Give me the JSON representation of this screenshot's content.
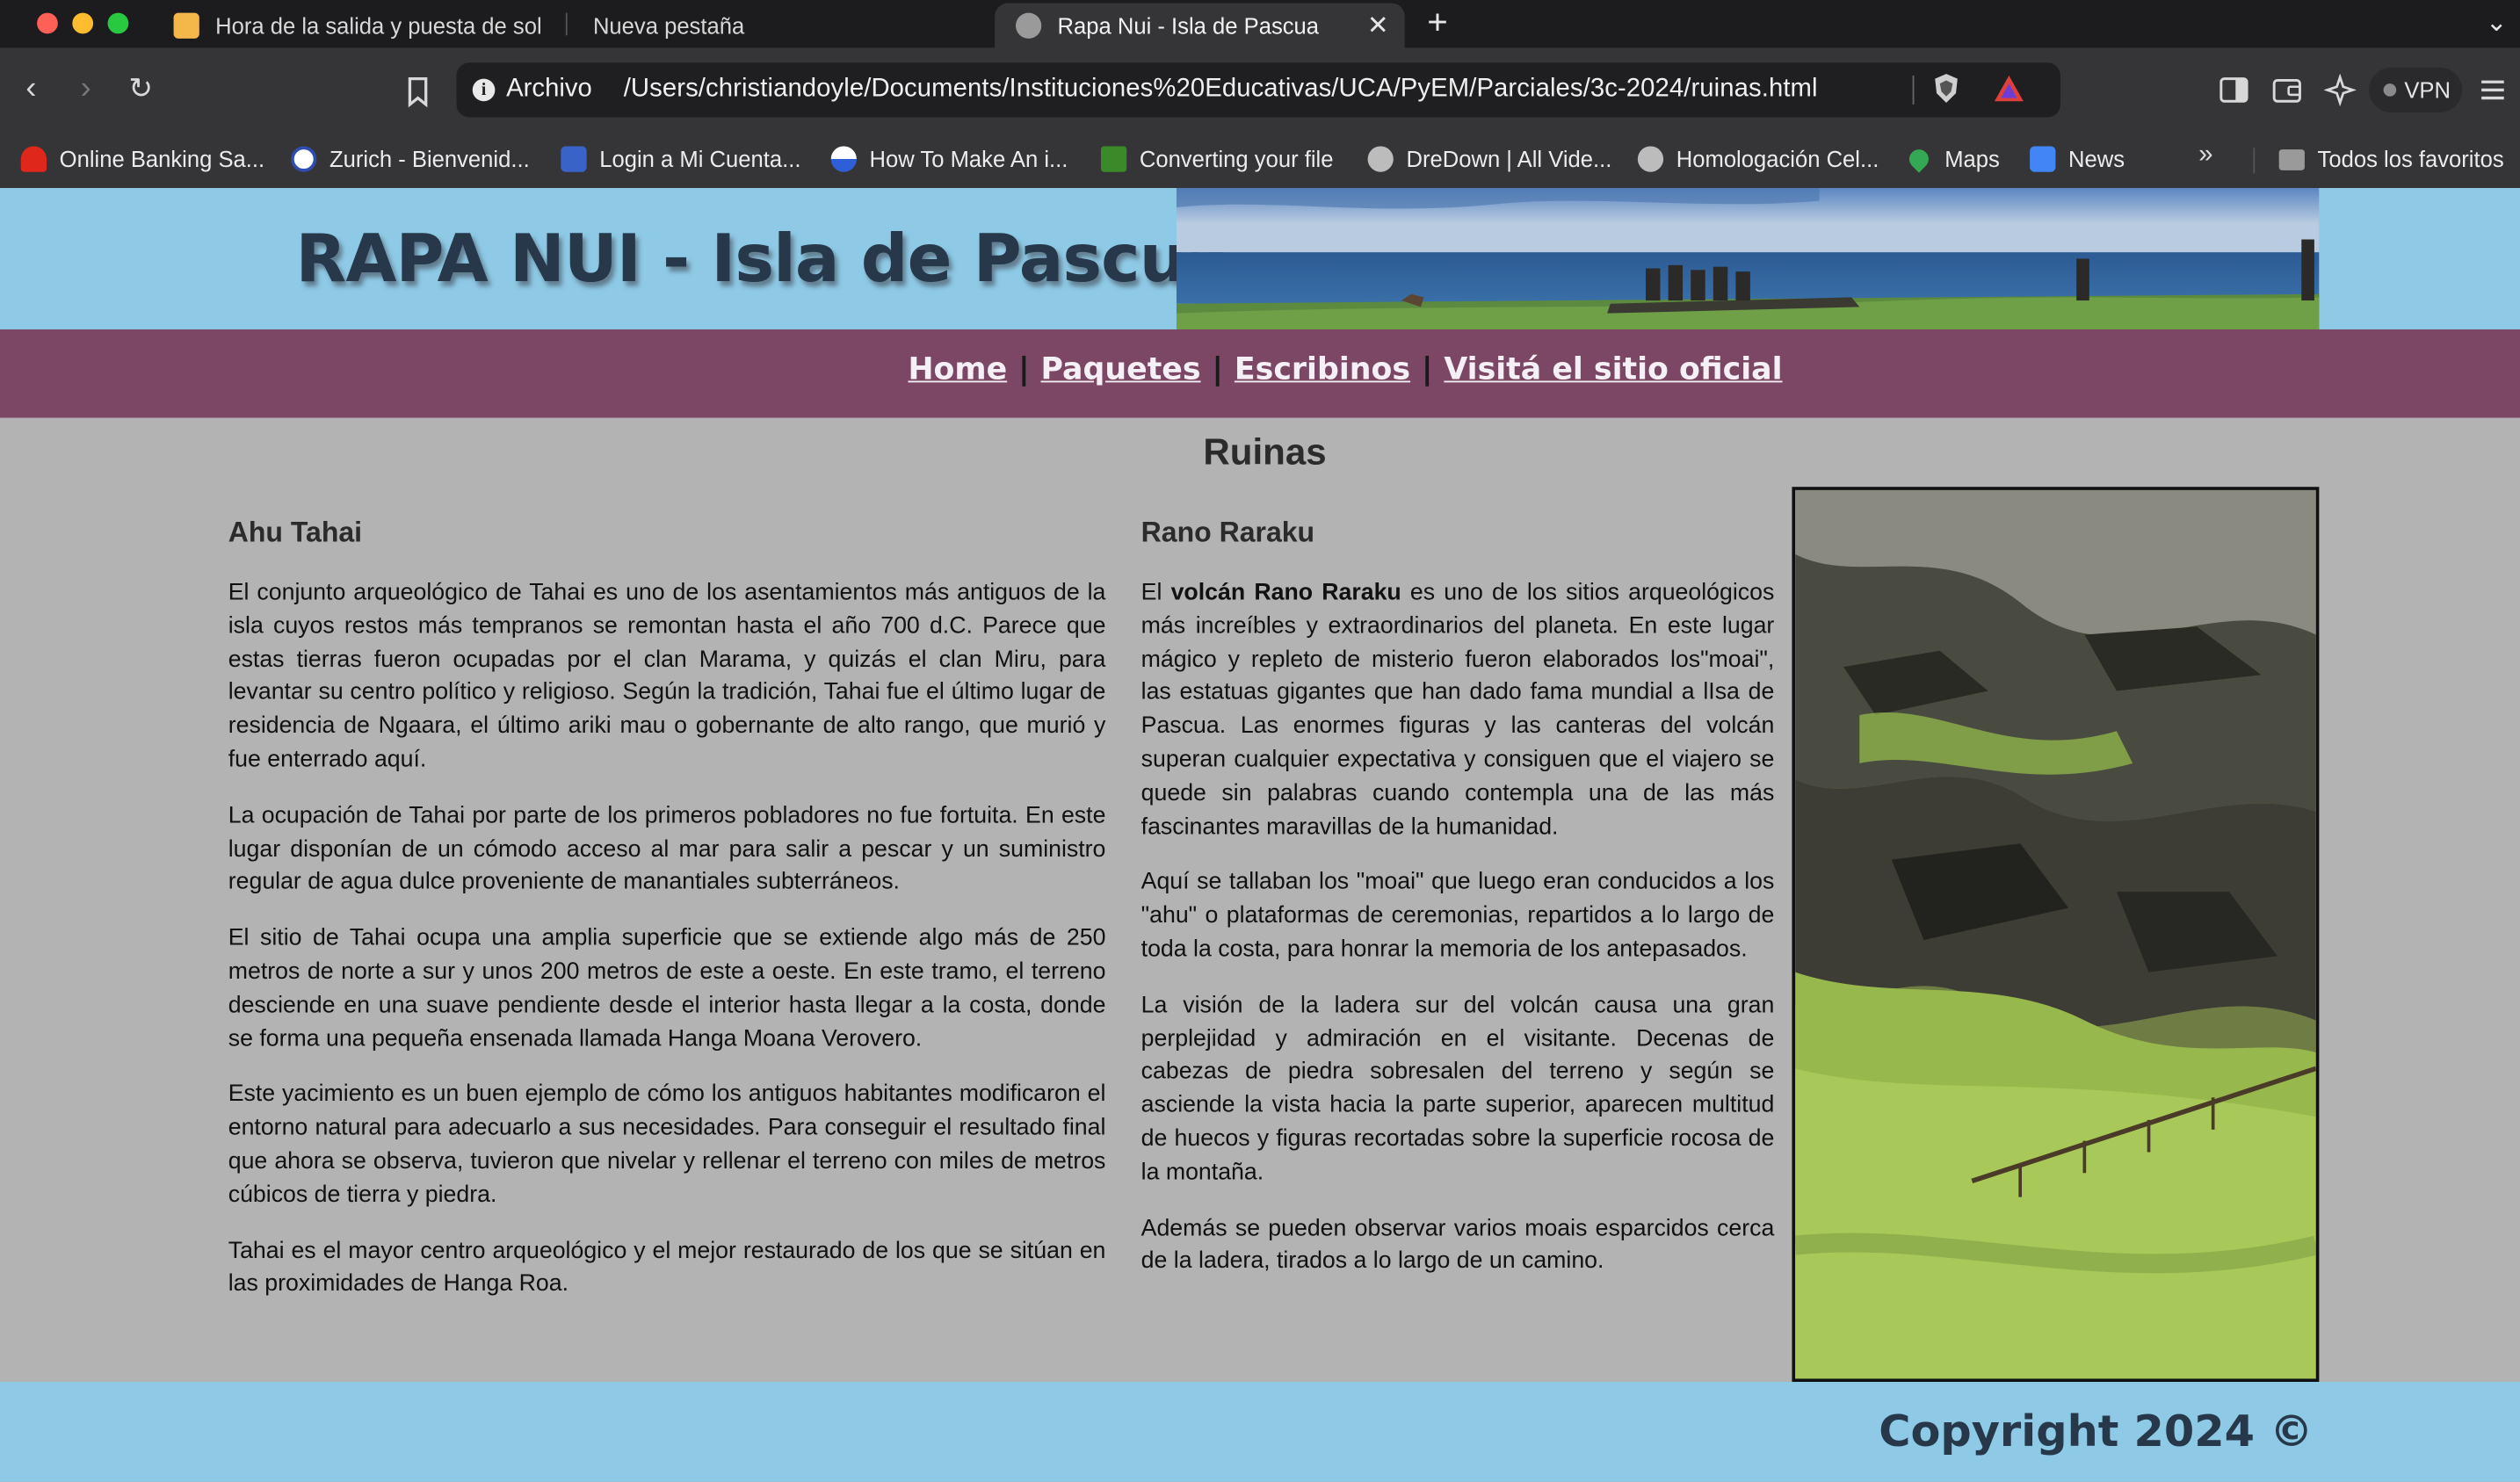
{
  "browser": {
    "tabs": [
      {
        "title": "Hora de la salida y puesta de sol |",
        "active": false
      },
      {
        "title": "Nueva pestaña",
        "active": false
      },
      {
        "title": "Rapa Nui - Isla de Pascua",
        "active": true
      }
    ],
    "new_tab_symbol": "+",
    "address": {
      "scheme_label": "Archivo",
      "url": "/Users/christiandoyle/Documents/Instituciones%20Educativas/UCA/PyEM/Parciales/3c-2024/ruinas.html"
    },
    "vpn_label": "VPN",
    "bookmarks": [
      {
        "label": "Online Banking Sa...",
        "icon": "santander-flame-icon",
        "color": "#e0271c"
      },
      {
        "label": "Zurich - Bienvenid...",
        "icon": "zurich-z-icon",
        "color": "#2f4db0"
      },
      {
        "label": "Login a Mi Cuenta...",
        "icon": "account-grid-icon",
        "color": "#3a63c9"
      },
      {
        "label": "How To Make An i...",
        "icon": "globe-half-icon",
        "color": "#2e5fd8"
      },
      {
        "label": "Converting your file",
        "icon": "convert-x-icon",
        "color": "#3a8a2a"
      },
      {
        "label": "DreDown | All Vide...",
        "icon": "globe-icon",
        "color": "#bcbcbc"
      },
      {
        "label": "Homologación Cel...",
        "icon": "globe-icon",
        "color": "#bcbcbc"
      },
      {
        "label": "Maps",
        "icon": "maps-pin-icon",
        "color": "#34a853"
      },
      {
        "label": "News",
        "icon": "news-icon",
        "color": "#4285f4"
      }
    ],
    "bookmarks_overflow": "»",
    "all_bookmarks_label": "Todos los favoritos"
  },
  "site": {
    "title": "RAPA NUI - Isla de Pascua",
    "nav": [
      {
        "label": "Home"
      },
      {
        "label": "Paquetes"
      },
      {
        "label": "Escribinos"
      },
      {
        "label": "Visitá el sitio oficial"
      }
    ],
    "nav_separator": "|",
    "heading": "Ruinas",
    "left": {
      "title": "Ahu Tahai",
      "paragraphs": [
        "El conjunto arqueológico de Tahai es uno de los asentamientos más antiguos de la isla cuyos restos más tempranos se remontan hasta el año 700 d.C. Parece que estas tierras fueron ocupadas por el clan Marama, y quizás el clan Miru, para levantar su centro político y religioso. Según la tradición, Tahai fue el último lugar de residencia de Ngaara, el último ariki mau o gobernante de alto rango, que murió y fue enterrado aquí.",
        "La ocupación de Tahai por parte de los primeros pobladores no fue fortuita. En este lugar disponían de un cómodo acceso al mar para salir a pescar y un suministro regular de agua dulce proveniente de manantiales subterráneos.",
        "El sitio de Tahai ocupa una amplia superficie que se extiende algo más de 250 metros de norte a sur y unos 200 metros de este a oeste. En este tramo, el terreno desciende en una suave pendiente desde el interior hasta llegar a la costa, donde se forma una pequeña ensenada llamada Hanga Moana Verovero.",
        "Este yacimiento es un buen ejemplo de cómo los antiguos habitantes modificaron el entorno natural para adecuarlo a sus necesidades. Para conseguir el resultado final que ahora se observa, tuvieron que nivelar y rellenar el terreno con miles de metros cúbicos de tierra y piedra.",
        "Tahai es el mayor centro arqueológico y el mejor restaurado de los que se sitúan en las proximidades de Hanga Roa."
      ]
    },
    "right": {
      "title": "Rano Raraku",
      "p1_before": "El ",
      "p1_bold": "volcán Rano Raraku",
      "p1_after": " es uno de los sitios arqueológicos más increíbles y extraordinarios del planeta. En este lugar mágico y repleto de misterio fueron elaborados los\"moai\", las estatuas gigantes que han dado fama mundial a lIsa de Pascua. Las enormes figuras y las canteras del volcán superan cualquier expectativa y consiguen que el viajero se quede sin palabras cuando contempla una de las más fascinantes maravillas de la humanidad.",
      "paragraphs": [
        "Aquí se tallaban los \"moai\" que luego eran conducidos a los \"ahu\" o plataformas de ceremonias, repartidos a lo largo de toda la costa, para honrar la memoria de los antepasados.",
        "La visión de la ladera sur del volcán causa una gran perplejidad y admiración en el visitante. Decenas de cabezas de piedra sobresalen del terreno y según se asciende la vista hacia la parte superior, aparecen multitud de huecos y figuras recortadas sobre la superficie rocosa de la montaña.",
        "Además se pueden observar varios moais esparcidos cerca de la ladera, tirados a lo largo de un camino."
      ]
    },
    "footer": "Copyright 2024  ©"
  },
  "colors": {
    "banner": "#8ecae6",
    "navbar": "#7c4764",
    "content_bg": "#b3b3b3",
    "title_text": "#26384a"
  }
}
